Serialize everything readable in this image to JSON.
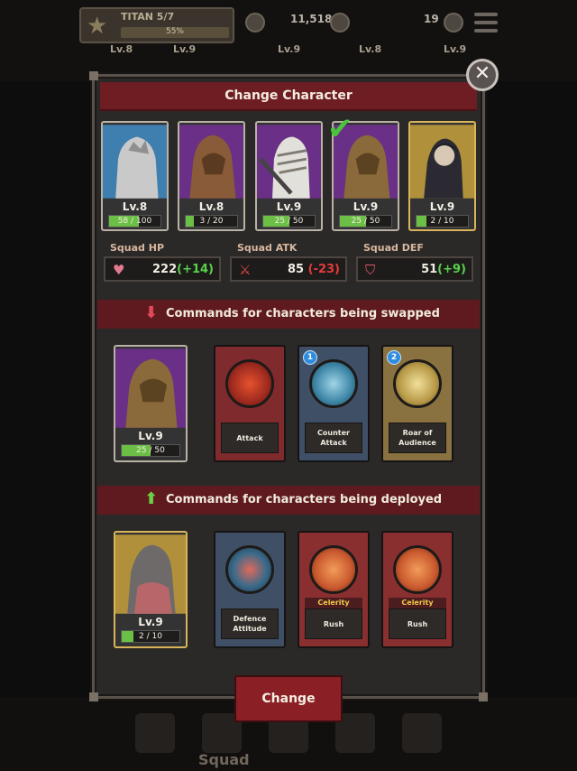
{
  "background": {
    "rank_name": "TITAN 5/7",
    "rank_progress": "55%",
    "resource_amount": "11,518",
    "energy_amount": "19",
    "bottom_tab_label": "Squad",
    "levels": [
      "Lv.8",
      "Lv.9",
      "Lv.9",
      "Lv.8",
      "Lv.9"
    ]
  },
  "modal": {
    "title": "Change Character",
    "close_symbol": "✕"
  },
  "characters": [
    {
      "level": "Lv.8",
      "xp": "58 / 100",
      "xp_fraction": 0.58,
      "bg": "#3f7fb0",
      "selected": false
    },
    {
      "level": "Lv.8",
      "xp": "3 / 20",
      "xp_fraction": 0.15,
      "bg": "#6a2f86",
      "selected": false
    },
    {
      "level": "Lv.9",
      "xp": "25 / 50",
      "xp_fraction": 0.5,
      "bg": "#6a2f86",
      "selected": false
    },
    {
      "level": "Lv.9",
      "xp": "25 / 50",
      "xp_fraction": 0.5,
      "bg": "#6a2f86",
      "selected": true
    },
    {
      "level": "Lv.9",
      "xp": "2 / 10",
      "xp_fraction": 0.2,
      "bg": "#b0903a",
      "selected": false
    }
  ],
  "stats": {
    "hp": {
      "label": "Squad HP",
      "value": "222",
      "delta": "(+14)"
    },
    "atk": {
      "label": "Squad ATK",
      "value": "85",
      "delta": "(-23)"
    },
    "def": {
      "label": "Squad DEF",
      "value": "51",
      "delta": "(+9)"
    }
  },
  "swapped": {
    "header": "Commands for characters being swapped",
    "character": {
      "level": "Lv.9",
      "xp": "25 / 50",
      "xp_fraction": 0.5
    },
    "commands": [
      {
        "name": "Attack",
        "badge": ""
      },
      {
        "name": "Counter Attack",
        "badge": "1"
      },
      {
        "name": "Roar of Audience",
        "badge": "2"
      }
    ]
  },
  "deployed": {
    "header": "Commands for characters being deployed",
    "character": {
      "level": "Lv.9",
      "xp": "2 / 10",
      "xp_fraction": 0.2
    },
    "commands": [
      {
        "name": "Defence Attitude",
        "tag": ""
      },
      {
        "name": "Rush",
        "tag": "Celerity"
      },
      {
        "name": "Rush",
        "tag": "Celerity"
      }
    ]
  },
  "change_button": "Change",
  "colors": {
    "accent_red": "#6e1d22",
    "up_green": "#58d14a",
    "down_red": "#e53b3b",
    "xp_green": "#6cbf45"
  }
}
